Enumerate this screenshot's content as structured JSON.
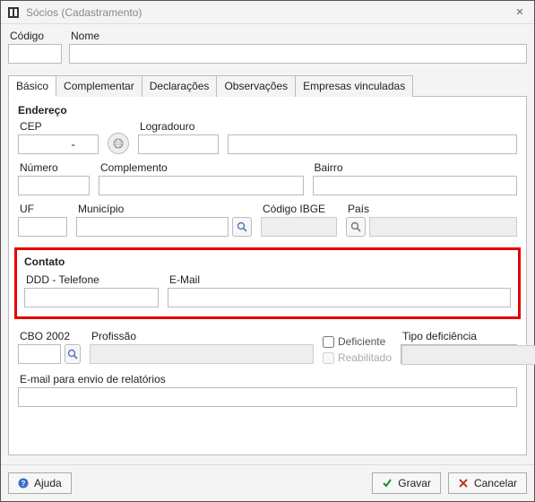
{
  "window": {
    "title": "Sócios (Cadastramento)"
  },
  "header": {
    "codigo_label": "Código",
    "nome_label": "Nome",
    "codigo_value": "",
    "nome_value": ""
  },
  "tabs": {
    "basico": "Básico",
    "complementar": "Complementar",
    "declaracoes": "Declarações",
    "observacoes": "Observações",
    "empresas": "Empresas vinculadas",
    "active": "Básico"
  },
  "endereco": {
    "section": "Endereço",
    "cep_label": "CEP",
    "cep_value": "          -",
    "logradouro_label": "Logradouro",
    "logradouro_tipo": "",
    "logradouro_value": "",
    "numero_label": "Número",
    "numero_value": "",
    "complemento_label": "Complemento",
    "complemento_value": "",
    "bairro_label": "Bairro",
    "bairro_value": "",
    "uf_label": "UF",
    "uf_value": "",
    "municipio_label": "Município",
    "municipio_value": "",
    "ibge_label": "Código IBGE",
    "ibge_value": "",
    "pais_label": "País",
    "pais_value": ""
  },
  "contato": {
    "section": "Contato",
    "ddd_label": "DDD - Telefone",
    "ddd_value": "",
    "email_label": "E-Mail",
    "email_value": ""
  },
  "profissao": {
    "cbo_label": "CBO 2002",
    "cbo_value": "",
    "profissao_label": "Profissão",
    "profissao_value": "",
    "deficiente_label": "Deficiente",
    "reabilitado_label": "Reabilitado",
    "tipo_def_label": "Tipo deficiência",
    "tipo_def_value": ""
  },
  "relatorios": {
    "label": "E-mail para envio de relatórios",
    "value": ""
  },
  "footer": {
    "ajuda": "Ajuda",
    "gravar": "Gravar",
    "cancelar": "Cancelar"
  }
}
